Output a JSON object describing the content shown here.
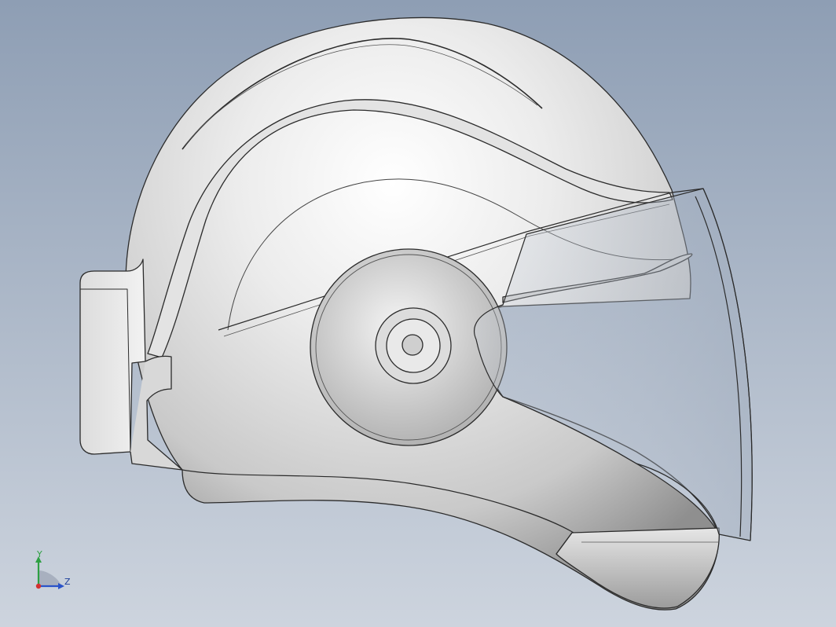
{
  "colors": {
    "background_top": "#8e9eb4",
    "background_bottom": "#cdd4de",
    "model_light": "#f2f2f2",
    "model_mid": "#d6d6d6",
    "model_dark": "#9a9a9a",
    "edge": "#2b2b2b",
    "visor_tint": "#a9b3c2",
    "axis_y": "#2ea043",
    "axis_z": "#2a53c9",
    "axis_origin": "#d33030",
    "axis_label": "#1d3f9a"
  },
  "model": {
    "icon": "motorcycle-helmet-3d-model"
  },
  "triad": {
    "y_label": "Y",
    "z_label": "Z"
  }
}
